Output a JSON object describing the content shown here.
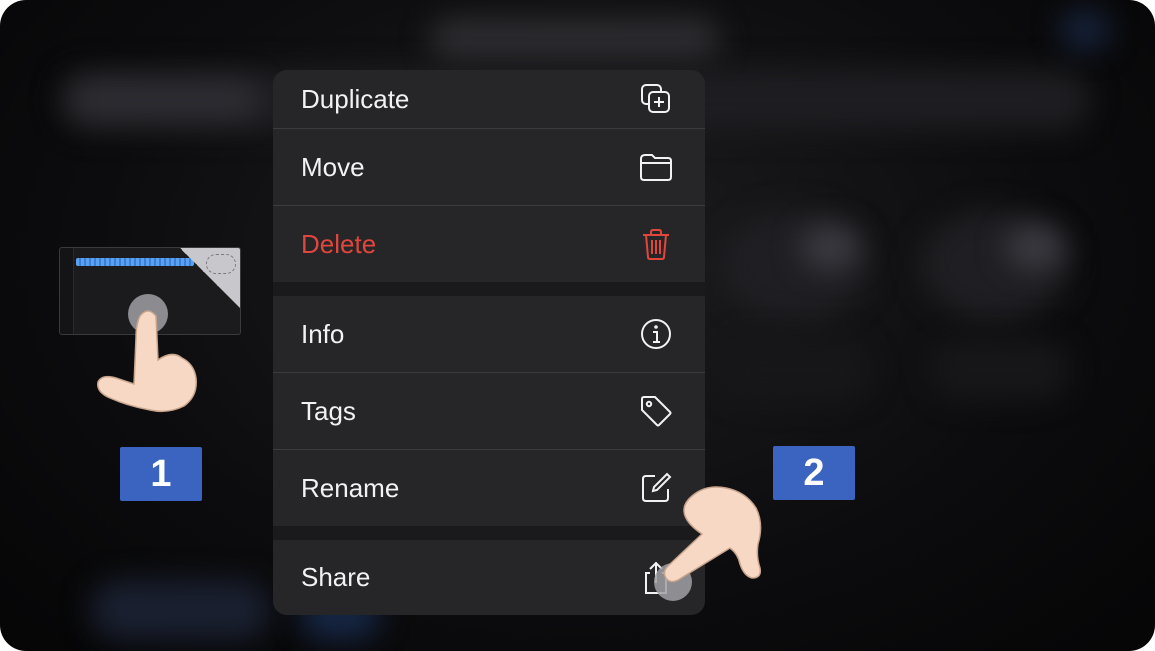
{
  "menu": {
    "items": [
      {
        "label": "Duplicate",
        "icon": "duplicate-icon"
      },
      {
        "label": "Move",
        "icon": "folder-icon"
      },
      {
        "label": "Delete",
        "icon": "trash-icon",
        "color": "#e0463b"
      },
      {
        "label": "Info",
        "icon": "info-icon"
      },
      {
        "label": "Tags",
        "icon": "tag-icon"
      },
      {
        "label": "Rename",
        "icon": "rename-icon"
      },
      {
        "label": "Share",
        "icon": "share-icon"
      }
    ]
  },
  "steps": {
    "step1": "1",
    "step2": "2"
  },
  "colors": {
    "badge": "#3b63c0",
    "destructive": "#e0463b",
    "menu_background": "#262628"
  }
}
